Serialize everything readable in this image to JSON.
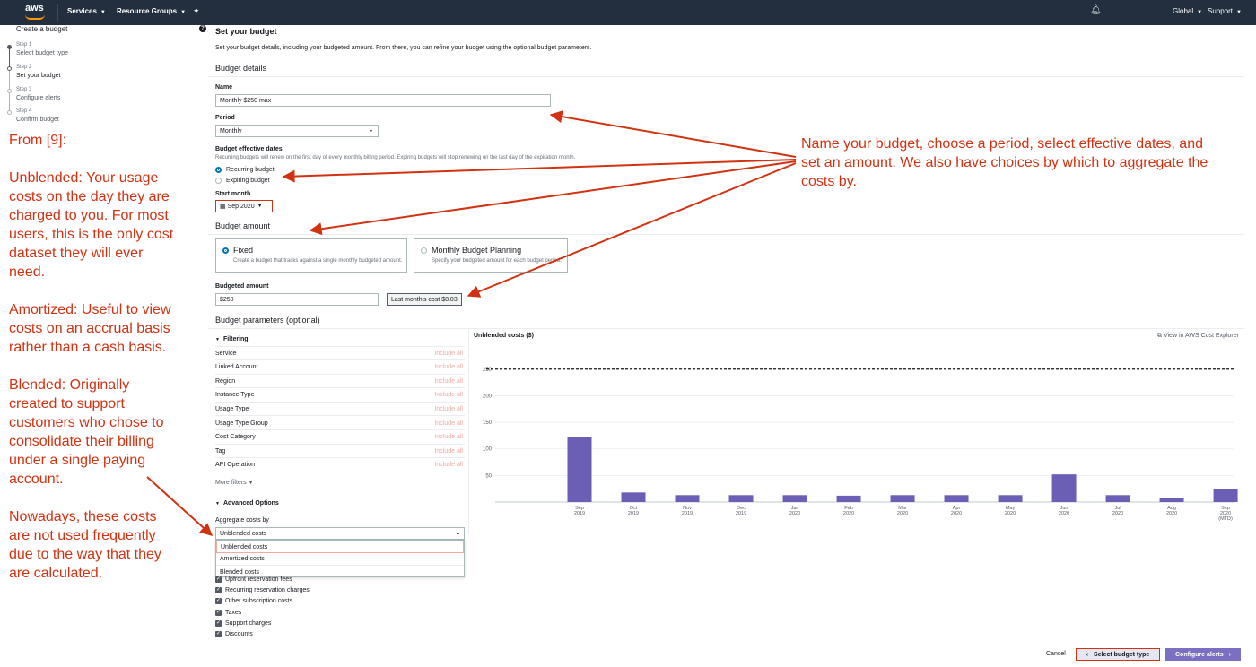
{
  "nav": {
    "logo": "aws",
    "services": "Services",
    "resource_groups": "Resource Groups",
    "region": "Global",
    "support": "Support"
  },
  "sidebar": {
    "title": "Create a budget",
    "steps": [
      {
        "num": "Step 1",
        "label": "Select budget type"
      },
      {
        "num": "Step 2",
        "label": "Set your budget"
      },
      {
        "num": "Step 3",
        "label": "Configure alerts"
      },
      {
        "num": "Step 4",
        "label": "Confirm budget"
      }
    ]
  },
  "annotations": {
    "left": [
      "From [9]:",
      "Unblended: Your usage costs on the day they are charged to you. For most users, this is the only cost dataset they will ever need.",
      "Amortized: Useful to view costs on an accrual basis rather than a cash basis.",
      "Blended: Originally created to support customers who chose to consolidate their billing under a single paying account.",
      "Nowadays, these costs are not used frequently due to the way that they are calculated."
    ],
    "right": "Name your budget, choose a period, select effective dates, and set an amount. We also have choices by which to aggregate the costs by."
  },
  "main": {
    "title": "Set your budget",
    "description": "Set your budget details, including your budgeted amount. From there, you can refine your budget using the optional budget parameters.",
    "details_heading": "Budget details",
    "name_label": "Name",
    "name_value": "Monthly $250 max",
    "period_label": "Period",
    "period_value": "Monthly",
    "dates_label": "Budget effective dates",
    "dates_hint": "Recurring budgets will renew on the first day of every monthly billing period. Expiring budgets will stop renewing on the last day of the expiration month.",
    "recurring": "Recurring budget",
    "expiring": "Expiring budget",
    "start_month_label": "Start month",
    "start_month_value": "Sep 2020",
    "amount_heading": "Budget amount",
    "fixed_title": "Fixed",
    "fixed_desc": "Create a budget that tracks against a single monthly budgeted amount.",
    "planning_title": "Monthly Budget Planning",
    "planning_desc": "Specify your budgeted amount for each budget period.",
    "budgeted_amount_label": "Budgeted amount",
    "budgeted_amount_value": "$250",
    "last_month_cost": "Last month's cost $8.03",
    "params_heading": "Budget parameters (optional)"
  },
  "filtering": {
    "heading": "Filtering",
    "include_all": "Include all",
    "rows": [
      "Service",
      "Linked Account",
      "Region",
      "Instance Type",
      "Usage Type",
      "Usage Type Group",
      "Cost Category",
      "Tag",
      "API Operation"
    ],
    "more_filters": "More filters"
  },
  "advanced": {
    "heading": "Advanced Options",
    "aggregate_label": "Aggregate costs by",
    "aggregate_value": "Unblended costs",
    "options": [
      "Unblended costs",
      "Amortized costs",
      "Blended costs"
    ],
    "checkboxes": [
      "Upfront reservation fees",
      "Recurring reservation charges",
      "Other subscription costs",
      "Taxes",
      "Support charges",
      "Discounts"
    ]
  },
  "chart_data": {
    "type": "bar",
    "title": "Unblended costs ($)",
    "categories": [
      "Sep 2019",
      "Oct 2019",
      "Nov 2019",
      "Dec 2019",
      "Jan 2020",
      "Feb 2020",
      "Mar 2020",
      "Apr 2020",
      "May 2020",
      "Jun 2020",
      "Jul 2020",
      "Aug 2020",
      "Sep 2020 (MTD)"
    ],
    "values": [
      122,
      18,
      13,
      13,
      13,
      12,
      13,
      13,
      13,
      52,
      13,
      8,
      24
    ],
    "yticks": [
      50,
      100,
      150,
      200,
      250
    ],
    "ylim": [
      0,
      280
    ],
    "budget_line": 250,
    "bar_color": "#6b5fb5",
    "grid": true
  },
  "chart": {
    "external_link": "View in AWS Cost Explorer"
  },
  "footer": {
    "cancel": "Cancel",
    "prev": "Select budget type",
    "next": "Configure alerts"
  },
  "colors": {
    "nav_bg": "#232f3e",
    "annotation": "#d13212",
    "primary": "#7a6fc0"
  }
}
